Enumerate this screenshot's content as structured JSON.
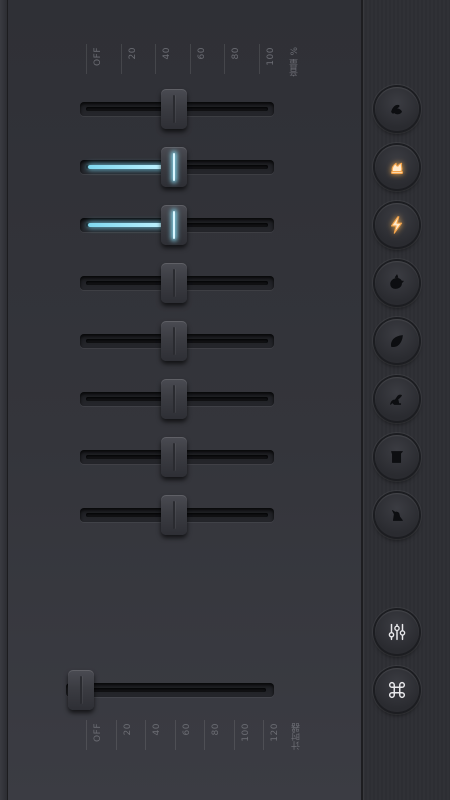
{
  "volume_scale": {
    "labels": [
      "OFF",
      "20",
      "40",
      "60",
      "80",
      "100"
    ],
    "unit": "音量 %"
  },
  "timer_scale": {
    "labels": [
      "OFF",
      "20",
      "40",
      "60",
      "80",
      "100",
      "120"
    ],
    "unit": "计时器"
  },
  "channels": [
    {
      "name": "wind",
      "level": 0,
      "active": false
    },
    {
      "name": "fire",
      "level": 45,
      "active": true
    },
    {
      "name": "thunder",
      "level": 45,
      "active": true
    },
    {
      "name": "birds",
      "level": 0,
      "active": false
    },
    {
      "name": "leaf",
      "level": 0,
      "active": false
    },
    {
      "name": "frog",
      "level": 0,
      "active": false
    },
    {
      "name": "river",
      "level": 0,
      "active": false
    },
    {
      "name": "cat",
      "level": 0,
      "active": false
    }
  ],
  "timer": {
    "minutes": 0,
    "label": "OFF"
  },
  "icons": {
    "channel_icons": [
      "wind-icon",
      "campfire-icon",
      "lightning-icon",
      "bird-icon",
      "leaf-icon",
      "frog-icon",
      "waterfall-icon",
      "cat-icon"
    ],
    "mixer_button": "sliders-icon",
    "app_button": "command-icon"
  },
  "colors": {
    "accent_fill": "#9be6fb",
    "active_icon": "#f3a34a",
    "icon_default": "#0d0e11"
  }
}
